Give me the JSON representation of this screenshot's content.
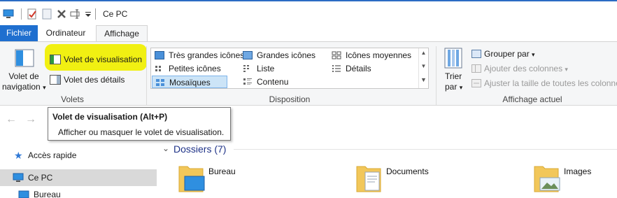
{
  "window": {
    "title": "Ce PC"
  },
  "tabs": [
    {
      "label": "Fichier"
    },
    {
      "label": "Ordinateur"
    },
    {
      "label": "Affichage"
    }
  ],
  "ribbon": {
    "volets": {
      "group_label": "Volets",
      "nav_pane_line1": "Volet de",
      "nav_pane_line2": "navigation",
      "nav_pane_arrow": "▾",
      "preview_pane": "Volet de visualisation",
      "details_pane": "Volet des détails"
    },
    "disposition": {
      "group_label": "Disposition",
      "items": [
        {
          "label": "Très grandes icônes"
        },
        {
          "label": "Grandes icônes"
        },
        {
          "label": "Icônes moyennes"
        },
        {
          "label": "Petites icônes"
        },
        {
          "label": "Liste"
        },
        {
          "label": "Détails"
        },
        {
          "label": "Mosaïques"
        },
        {
          "label": "Contenu"
        }
      ],
      "selected": "Mosaïques"
    },
    "affichage_actuel": {
      "group_label": "Affichage actuel",
      "sort_line1": "Trier",
      "sort_line2": "par",
      "sort_arrow": "▾",
      "group_by": "Grouper par",
      "group_by_arrow": "▾",
      "add_columns": "Ajouter des colonnes",
      "add_columns_arrow": "▾",
      "fit_columns": "Ajuster la taille de toutes les colonnes"
    }
  },
  "tooltip": {
    "title": "Volet de visualisation (Alt+P)",
    "description": "Afficher ou masquer le volet de visualisation."
  },
  "nav": {
    "back": "←",
    "forward": "→"
  },
  "navpane": {
    "items": [
      {
        "label": "Accès rapide"
      },
      {
        "label": "Ce PC"
      },
      {
        "label": "Bureau"
      }
    ]
  },
  "content": {
    "section_title": "Dossiers (7)",
    "folders": [
      {
        "name": "Bureau"
      },
      {
        "name": "Documents"
      },
      {
        "name": "Images"
      }
    ]
  },
  "colors": {
    "accent": "#1f6fcf",
    "highlight": "#f1f012",
    "selected_layout": "#cce4f7"
  }
}
